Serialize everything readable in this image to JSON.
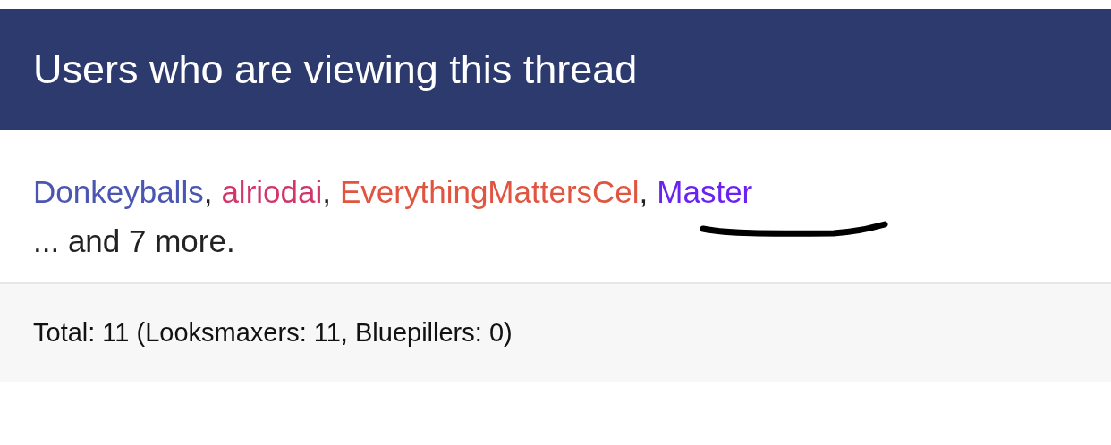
{
  "header": {
    "title": "Users who are viewing this thread"
  },
  "viewers": [
    {
      "name": "Donkeyballs",
      "color": "#4a56b2"
    },
    {
      "name": "alriodai",
      "color": "#d0356b"
    },
    {
      "name": "EverythingMattersCel",
      "color": "#e1543f"
    },
    {
      "name": "Master",
      "color": "#6a22f2"
    }
  ],
  "separator": ",",
  "more": "... and 7 more.",
  "footer": {
    "total": "Total: 11 (Looksmaxers: 11, Bluepillers: 0)"
  }
}
